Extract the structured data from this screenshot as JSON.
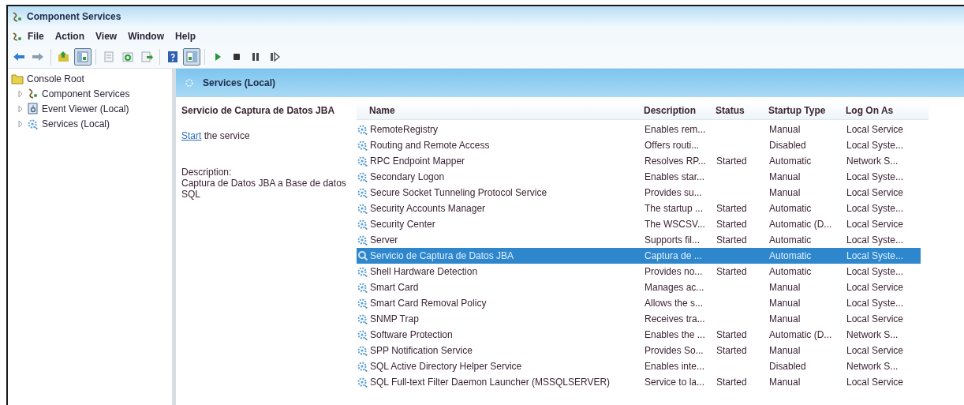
{
  "window": {
    "title": "Component Services"
  },
  "menu": [
    "File",
    "Action",
    "View",
    "Window",
    "Help"
  ],
  "toolbar": [
    {
      "kind": "back",
      "pressed": false
    },
    {
      "kind": "forward",
      "pressed": false
    },
    {
      "kind": "separator"
    },
    {
      "kind": "up",
      "pressed": false
    },
    {
      "kind": "tree",
      "pressed": true
    },
    {
      "kind": "separator"
    },
    {
      "kind": "properties",
      "pressed": false
    },
    {
      "kind": "refresh",
      "pressed": false
    },
    {
      "kind": "export",
      "pressed": false
    },
    {
      "kind": "separator"
    },
    {
      "kind": "help",
      "pressed": false
    },
    {
      "kind": "pane",
      "pressed": true
    },
    {
      "kind": "separator"
    },
    {
      "kind": "play",
      "pressed": false
    },
    {
      "kind": "stop",
      "pressed": false
    },
    {
      "kind": "pause",
      "pressed": false
    },
    {
      "kind": "resume",
      "pressed": false
    }
  ],
  "tree": {
    "label": "Console Root",
    "children": [
      {
        "label": "Component Services",
        "kind": "component",
        "expanded": false
      },
      {
        "label": "Event Viewer (Local)",
        "kind": "events",
        "expanded": false
      },
      {
        "label": "Services (Local)",
        "kind": "services",
        "expanded": false
      }
    ]
  },
  "pane": {
    "title": "Services (Local)",
    "detail": {
      "title": "Servicio de Captura de Datos JBA",
      "action_link": "Start",
      "action_text": "the service",
      "description_label": "Description:",
      "description": "Captura de Datos JBA a Base de datos SQL"
    },
    "table": {
      "columns": [
        "Name",
        "Description",
        "Status",
        "Startup Type",
        "Log On As"
      ],
      "rows": [
        {
          "cells": [
            "RemoteRegistry",
            "Enables rem...",
            "",
            "Manual",
            "Local Service"
          ],
          "selected": false
        },
        {
          "cells": [
            "Routing and Remote Access",
            "Offers routi...",
            "",
            "Disabled",
            "Local Syste..."
          ],
          "selected": false
        },
        {
          "cells": [
            "RPC Endpoint Mapper",
            "Resolves RP...",
            "Started",
            "Automatic",
            "Network S..."
          ],
          "selected": false
        },
        {
          "cells": [
            "Secondary Logon",
            "Enables star...",
            "",
            "Manual",
            "Local Syste..."
          ],
          "selected": false
        },
        {
          "cells": [
            "Secure Socket Tunneling Protocol Service",
            "Provides su...",
            "",
            "Manual",
            "Local Service"
          ],
          "selected": false
        },
        {
          "cells": [
            "Security Accounts Manager",
            "The startup ...",
            "Started",
            "Automatic",
            "Local Syste..."
          ],
          "selected": false
        },
        {
          "cells": [
            "Security Center",
            "The WSCSV...",
            "Started",
            "Automatic (D...",
            "Local Service"
          ],
          "selected": false
        },
        {
          "cells": [
            "Server",
            "Supports fil...",
            "Started",
            "Automatic",
            "Local Syste..."
          ],
          "selected": false
        },
        {
          "cells": [
            "Servicio de Captura de Datos JBA",
            "Captura de ...",
            "",
            "Automatic",
            "Local Syste..."
          ],
          "selected": true
        },
        {
          "cells": [
            "Shell Hardware Detection",
            "Provides no...",
            "Started",
            "Automatic",
            "Local Syste..."
          ],
          "selected": false
        },
        {
          "cells": [
            "Smart Card",
            "Manages ac...",
            "",
            "Manual",
            "Local Service"
          ],
          "selected": false
        },
        {
          "cells": [
            "Smart Card Removal Policy",
            "Allows the s...",
            "",
            "Manual",
            "Local Syste..."
          ],
          "selected": false
        },
        {
          "cells": [
            "SNMP Trap",
            "Receives tra...",
            "",
            "Manual",
            "Local Service"
          ],
          "selected": false
        },
        {
          "cells": [
            "Software Protection",
            "Enables the ...",
            "Started",
            "Automatic (D...",
            "Network S..."
          ],
          "selected": false
        },
        {
          "cells": [
            "SPP Notification Service",
            "Provides So...",
            "Started",
            "Manual",
            "Local Service"
          ],
          "selected": false
        },
        {
          "cells": [
            "SQL Active Directory Helper Service",
            "Enables inte...",
            "",
            "Disabled",
            "Network S..."
          ],
          "selected": false
        },
        {
          "cells": [
            "SQL Full-text Filter Daemon Launcher (MSSQLSERVER)",
            "Service to la...",
            "Started",
            "Manual",
            "Local Service"
          ],
          "selected": false
        }
      ]
    }
  }
}
